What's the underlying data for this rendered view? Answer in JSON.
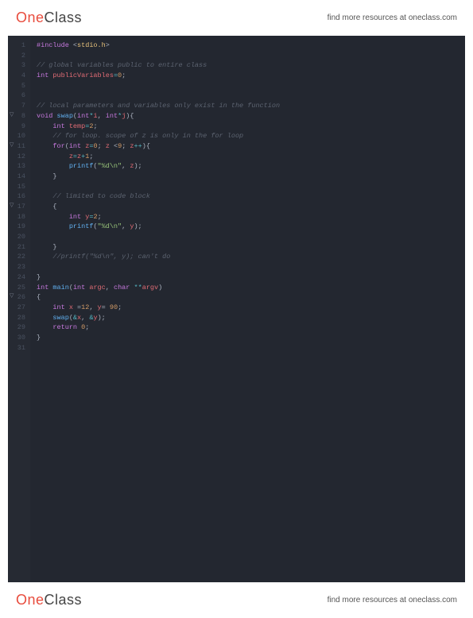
{
  "brand": {
    "part1": "One",
    "part2": "Class"
  },
  "tagline": "find more resources at oneclass.com",
  "code": {
    "lines": [
      {
        "n": 1,
        "fold": "",
        "tokens": [
          [
            "kw-pp",
            "#include"
          ],
          [
            "punc",
            " <"
          ],
          [
            "ident",
            "stdio.h"
          ],
          [
            "punc",
            ">"
          ]
        ]
      },
      {
        "n": 2,
        "fold": "",
        "tokens": []
      },
      {
        "n": 3,
        "fold": "",
        "tokens": [
          [
            "cmt",
            "// global variables public to entire class"
          ]
        ]
      },
      {
        "n": 4,
        "fold": "",
        "tokens": [
          [
            "kw-type",
            "int"
          ],
          [
            "punc",
            " "
          ],
          [
            "var",
            "publicVariables"
          ],
          [
            "op",
            "="
          ],
          [
            "num",
            "0"
          ],
          [
            "punc",
            ";"
          ]
        ]
      },
      {
        "n": 5,
        "fold": "",
        "tokens": []
      },
      {
        "n": 6,
        "fold": "",
        "tokens": []
      },
      {
        "n": 7,
        "fold": "",
        "tokens": [
          [
            "cmt",
            "// local parameters and variables only exist in the function"
          ]
        ]
      },
      {
        "n": 8,
        "fold": "▽",
        "tokens": [
          [
            "kw-type",
            "void"
          ],
          [
            "punc",
            " "
          ],
          [
            "fn",
            "swap"
          ],
          [
            "punc",
            "("
          ],
          [
            "kw-type",
            "int"
          ],
          [
            "op",
            "*"
          ],
          [
            "var",
            "i"
          ],
          [
            "punc",
            ", "
          ],
          [
            "kw-type",
            "int"
          ],
          [
            "op",
            "*"
          ],
          [
            "var",
            "j"
          ],
          [
            "punc",
            "){"
          ]
        ]
      },
      {
        "n": 9,
        "fold": "",
        "tokens": [
          [
            "punc",
            "    "
          ],
          [
            "kw-type",
            "int"
          ],
          [
            "punc",
            " "
          ],
          [
            "var",
            "temp"
          ],
          [
            "op",
            "="
          ],
          [
            "num",
            "2"
          ],
          [
            "punc",
            ";"
          ]
        ]
      },
      {
        "n": 10,
        "fold": "",
        "tokens": [
          [
            "punc",
            "    "
          ],
          [
            "cmt",
            "// for loop. scope of z is only in the for loop"
          ]
        ]
      },
      {
        "n": 11,
        "fold": "▽",
        "tokens": [
          [
            "punc",
            "    "
          ],
          [
            "kw-ctrl",
            "for"
          ],
          [
            "punc",
            "("
          ],
          [
            "kw-type",
            "int"
          ],
          [
            "punc",
            " "
          ],
          [
            "var",
            "z"
          ],
          [
            "op",
            "="
          ],
          [
            "num",
            "0"
          ],
          [
            "punc",
            "; "
          ],
          [
            "var",
            "z"
          ],
          [
            "punc",
            " <"
          ],
          [
            "num",
            "9"
          ],
          [
            "punc",
            "; "
          ],
          [
            "var",
            "z"
          ],
          [
            "op",
            "++"
          ],
          [
            "punc",
            "){"
          ]
        ]
      },
      {
        "n": 12,
        "fold": "",
        "tokens": [
          [
            "punc",
            "        "
          ],
          [
            "var",
            "z"
          ],
          [
            "op",
            "="
          ],
          [
            "var",
            "z"
          ],
          [
            "op",
            "+"
          ],
          [
            "num",
            "1"
          ],
          [
            "punc",
            ";"
          ]
        ]
      },
      {
        "n": 13,
        "fold": "",
        "tokens": [
          [
            "punc",
            "        "
          ],
          [
            "fn",
            "printf"
          ],
          [
            "punc",
            "("
          ],
          [
            "str",
            "\"%d\\n\""
          ],
          [
            "punc",
            ", "
          ],
          [
            "var",
            "z"
          ],
          [
            "punc",
            ");"
          ]
        ]
      },
      {
        "n": 14,
        "fold": "",
        "tokens": [
          [
            "punc",
            "    }"
          ]
        ]
      },
      {
        "n": 15,
        "fold": "",
        "tokens": []
      },
      {
        "n": 16,
        "fold": "",
        "tokens": [
          [
            "punc",
            "    "
          ],
          [
            "cmt",
            "// limited to code block"
          ]
        ]
      },
      {
        "n": 17,
        "fold": "▽",
        "tokens": [
          [
            "punc",
            "    {"
          ]
        ]
      },
      {
        "n": 18,
        "fold": "",
        "tokens": [
          [
            "punc",
            "        "
          ],
          [
            "kw-type",
            "int"
          ],
          [
            "punc",
            " "
          ],
          [
            "var",
            "y"
          ],
          [
            "op",
            "="
          ],
          [
            "num",
            "2"
          ],
          [
            "punc",
            ";"
          ]
        ]
      },
      {
        "n": 19,
        "fold": "",
        "tokens": [
          [
            "punc",
            "        "
          ],
          [
            "fn",
            "printf"
          ],
          [
            "punc",
            "("
          ],
          [
            "str",
            "\"%d\\n\""
          ],
          [
            "punc",
            ", "
          ],
          [
            "var",
            "y"
          ],
          [
            "punc",
            ");"
          ]
        ]
      },
      {
        "n": 20,
        "fold": "",
        "tokens": []
      },
      {
        "n": 21,
        "fold": "",
        "tokens": [
          [
            "punc",
            "    }"
          ]
        ]
      },
      {
        "n": 22,
        "fold": "",
        "tokens": [
          [
            "punc",
            "    "
          ],
          [
            "cmt",
            "//printf(\"%d\\n\", y); can't do"
          ]
        ]
      },
      {
        "n": 23,
        "fold": "",
        "tokens": []
      },
      {
        "n": 24,
        "fold": "",
        "tokens": [
          [
            "punc",
            "}"
          ]
        ]
      },
      {
        "n": 25,
        "fold": "",
        "tokens": [
          [
            "kw-type",
            "int"
          ],
          [
            "punc",
            " "
          ],
          [
            "fn",
            "main"
          ],
          [
            "punc",
            "("
          ],
          [
            "kw-type",
            "int"
          ],
          [
            "punc",
            " "
          ],
          [
            "var",
            "argc"
          ],
          [
            "punc",
            ", "
          ],
          [
            "kw-type",
            "char"
          ],
          [
            "punc",
            " "
          ],
          [
            "op",
            "**"
          ],
          [
            "var",
            "argv"
          ],
          [
            "punc",
            ")"
          ]
        ]
      },
      {
        "n": 26,
        "fold": "▽",
        "tokens": [
          [
            "punc",
            "{"
          ]
        ]
      },
      {
        "n": 27,
        "fold": "",
        "tokens": [
          [
            "punc",
            "    "
          ],
          [
            "kw-type",
            "int"
          ],
          [
            "punc",
            " "
          ],
          [
            "var",
            "x"
          ],
          [
            "punc",
            " ="
          ],
          [
            "num",
            "12"
          ],
          [
            "punc",
            ", "
          ],
          [
            "var",
            "y"
          ],
          [
            "punc",
            "= "
          ],
          [
            "num",
            "90"
          ],
          [
            "punc",
            ";"
          ]
        ]
      },
      {
        "n": 28,
        "fold": "",
        "tokens": [
          [
            "punc",
            "    "
          ],
          [
            "fn",
            "swap"
          ],
          [
            "punc",
            "("
          ],
          [
            "op",
            "&"
          ],
          [
            "var",
            "x"
          ],
          [
            "punc",
            ", "
          ],
          [
            "op",
            "&"
          ],
          [
            "var",
            "y"
          ],
          [
            "punc",
            ");"
          ]
        ]
      },
      {
        "n": 29,
        "fold": "",
        "tokens": [
          [
            "punc",
            "    "
          ],
          [
            "kw-ctrl",
            "return"
          ],
          [
            "punc",
            " "
          ],
          [
            "num",
            "0"
          ],
          [
            "punc",
            ";"
          ]
        ]
      },
      {
        "n": 30,
        "fold": "",
        "tokens": [
          [
            "punc",
            "}"
          ]
        ]
      },
      {
        "n": 31,
        "fold": "",
        "tokens": []
      }
    ]
  }
}
